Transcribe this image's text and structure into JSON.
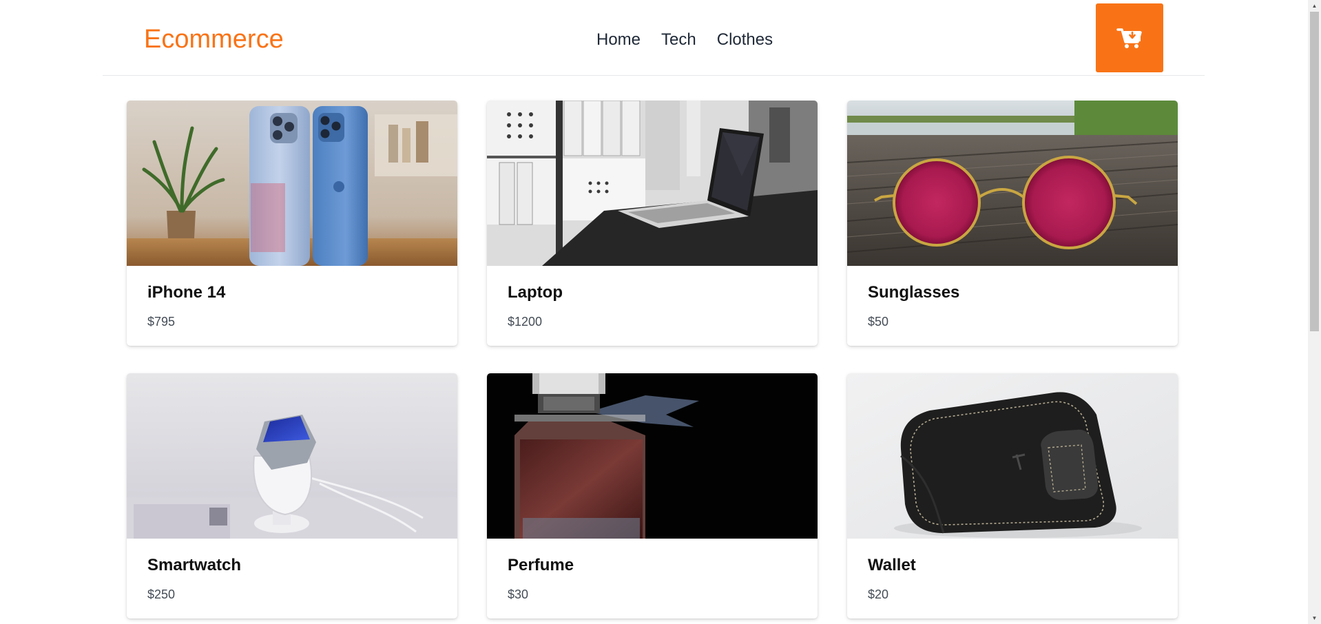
{
  "header": {
    "logo": "Ecommerce",
    "nav": [
      {
        "label": "Home"
      },
      {
        "label": "Tech"
      },
      {
        "label": "Clothes"
      }
    ],
    "cart_icon": "cart-download-icon"
  },
  "products": [
    {
      "name": "iPhone 14",
      "price": "$795",
      "image": "iphone-photo"
    },
    {
      "name": "Laptop",
      "price": "$1200",
      "image": "laptop-photo"
    },
    {
      "name": "Sunglasses",
      "price": "$50",
      "image": "sunglasses-photo"
    },
    {
      "name": "Smartwatch",
      "price": "$250",
      "image": "smartwatch-photo"
    },
    {
      "name": "Perfume",
      "price": "$30",
      "image": "perfume-photo"
    },
    {
      "name": "Wallet",
      "price": "$20",
      "image": "wallet-photo"
    }
  ],
  "colors": {
    "accent": "#f97316",
    "text": "#1f2937",
    "price": "#444c56"
  }
}
